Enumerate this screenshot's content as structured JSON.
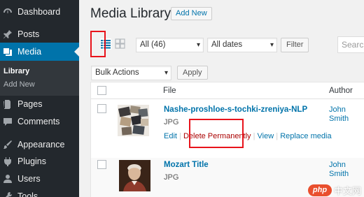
{
  "sidebar": {
    "items": [
      {
        "label": "Dashboard",
        "icon": "dashboard-icon"
      },
      {
        "label": "Posts",
        "icon": "pin-icon"
      },
      {
        "label": "Media",
        "icon": "media-icon"
      },
      {
        "label": "Pages",
        "icon": "pages-icon"
      },
      {
        "label": "Comments",
        "icon": "comments-icon"
      },
      {
        "label": "Appearance",
        "icon": "brush-icon"
      },
      {
        "label": "Plugins",
        "icon": "plugin-icon"
      },
      {
        "label": "Users",
        "icon": "users-icon"
      },
      {
        "label": "Tools",
        "icon": "tools-icon"
      }
    ],
    "submenu": {
      "library": "Library",
      "add_new": "Add New"
    },
    "colors": {
      "bg": "#23282d",
      "active": "#0073aa",
      "submenu_bg": "#32373c"
    }
  },
  "header": {
    "title": "Media Library",
    "add_new": "Add New"
  },
  "toolbar": {
    "type_filter": "All (46)",
    "date_filter": "All dates",
    "filter_button": "Filter",
    "search_placeholder": "Search",
    "bulk_actions": "Bulk Actions",
    "apply_button": "Apply",
    "view_modes": [
      "list-view-icon",
      "grid-view-icon"
    ]
  },
  "table": {
    "columns": {
      "file": "File",
      "author": "Author"
    },
    "rows": [
      {
        "title": "Nashe-proshloe-s-tochki-zreniya-NLP",
        "type": "JPG",
        "actions": {
          "edit": "Edit",
          "delete": "Delete Permanently",
          "view": "View",
          "replace": "Replace media"
        },
        "author_first": "John",
        "author_last": "Smith"
      },
      {
        "title": "Mozart Title",
        "type": "JPG",
        "author_first": "John",
        "author_last": "Smith"
      }
    ]
  },
  "highlight_color": "#e8131b",
  "watermark": {
    "logo": "php",
    "text": "中文网"
  }
}
